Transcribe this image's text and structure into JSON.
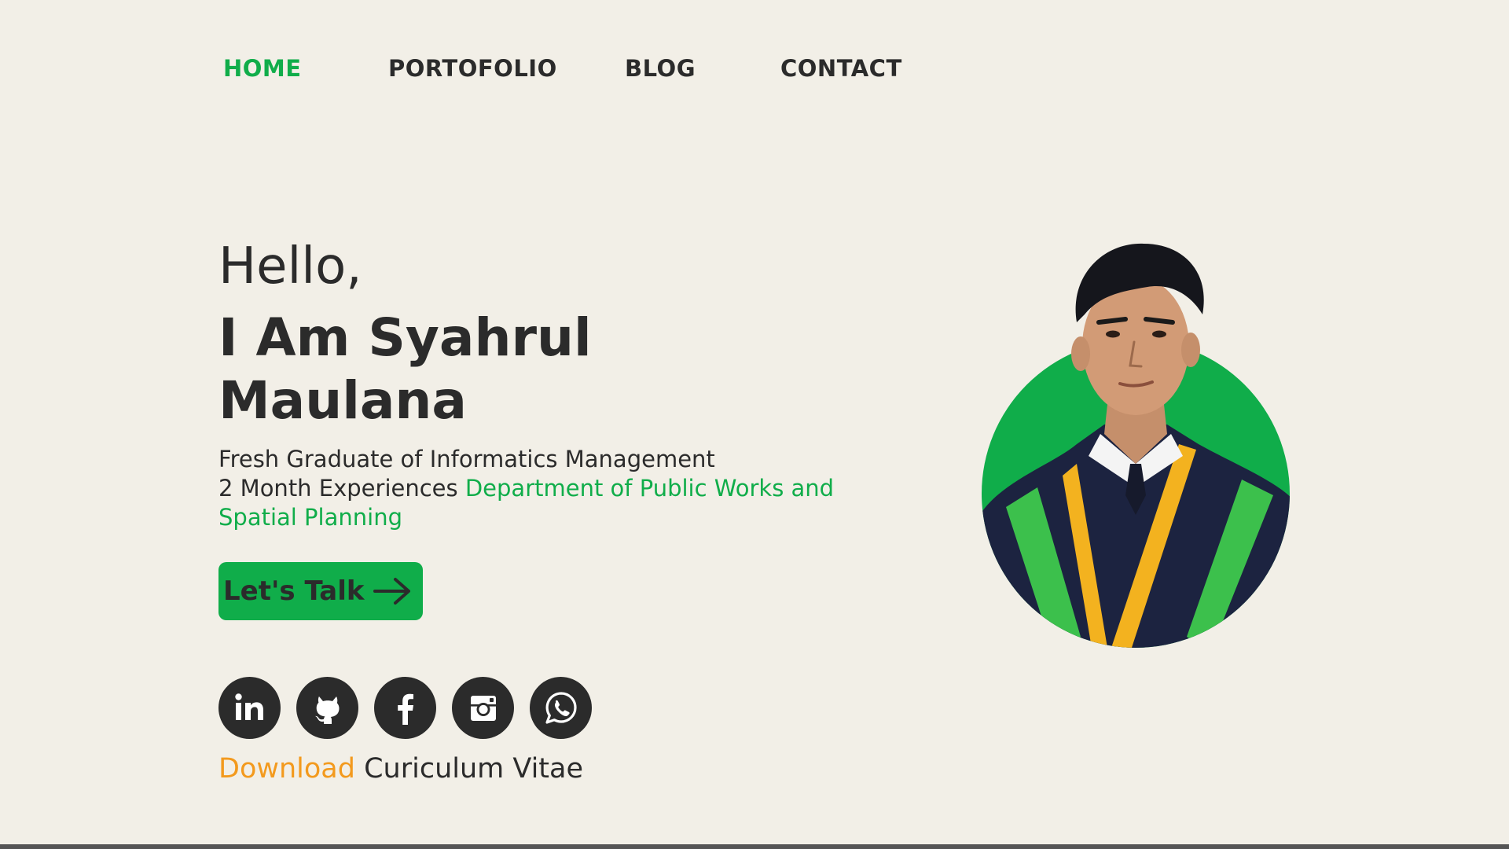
{
  "nav": {
    "items": [
      {
        "label": "HOME",
        "active": true
      },
      {
        "label": "PORTOFOLIO",
        "active": false
      },
      {
        "label": "BLOG",
        "active": false
      },
      {
        "label": "CONTACT",
        "active": false
      }
    ]
  },
  "hero": {
    "greeting": "Hello,",
    "name": "I Am Syahrul Maulana",
    "line1": "Fresh Graduate of Informatics Management",
    "line2_prefix": "2 Month Experiences ",
    "line2_highlight": "Department of Public Works and Spatial Planning",
    "cta_label": "Let's Talk",
    "cta_icon": "arrow-right-icon"
  },
  "socials": [
    {
      "name": "linkedin-icon"
    },
    {
      "name": "github-icon"
    },
    {
      "name": "facebook-icon"
    },
    {
      "name": "instagram-icon"
    },
    {
      "name": "whatsapp-icon"
    }
  ],
  "cv": {
    "download_label": "Download",
    "text": " Curiculum Vitae"
  },
  "colors": {
    "background": "#f2efe7",
    "accent_green": "#10ad4a",
    "accent_orange": "#f39a1e",
    "text_dark": "#2b2b2b"
  }
}
